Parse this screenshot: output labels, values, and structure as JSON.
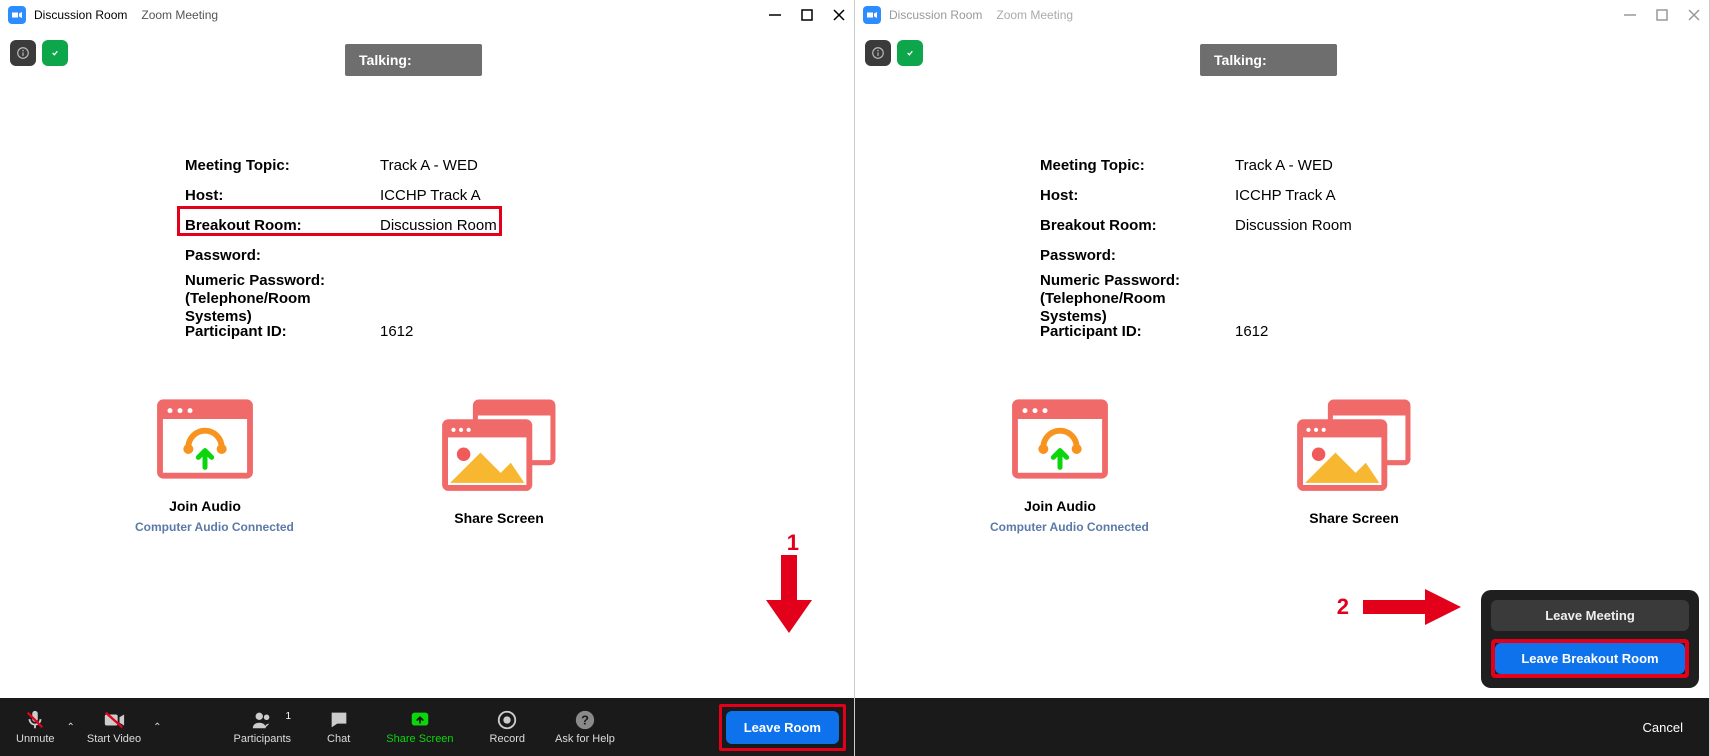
{
  "left": {
    "titlebar": {
      "room": "Discussion Room",
      "app": "Zoom Meeting"
    },
    "talking_label": "Talking:",
    "info": {
      "rows": [
        {
          "label": "Meeting Topic:",
          "value": "Track A - WED"
        },
        {
          "label": "Host:",
          "value": "ICCHP Track A"
        },
        {
          "label": "Breakout Room:",
          "value": "Discussion Room"
        },
        {
          "label": "Password:",
          "value": ""
        },
        {
          "label": "Numeric Password:\n(Telephone/Room Systems)",
          "value": ""
        },
        {
          "label": "Participant ID:",
          "value": "1612"
        }
      ]
    },
    "tiles": {
      "join_audio": "Join Audio",
      "share_screen": "Share Screen"
    },
    "audio_note": "Computer Audio Connected",
    "annotation": {
      "number": "1"
    },
    "toolbar": {
      "unmute": "Unmute",
      "start_video": "Start Video",
      "participants": "Participants",
      "participant_count": "1",
      "chat": "Chat",
      "share_screen": "Share Screen",
      "record": "Record",
      "ask_help": "Ask for Help",
      "leave_room": "Leave Room"
    }
  },
  "right": {
    "titlebar": {
      "room": "Discussion Room",
      "app": "Zoom Meeting"
    },
    "talking_label": "Talking:",
    "info": {
      "rows": [
        {
          "label": "Meeting Topic:",
          "value": "Track A - WED"
        },
        {
          "label": "Host:",
          "value": "ICCHP Track A"
        },
        {
          "label": "Breakout Room:",
          "value": "Discussion Room"
        },
        {
          "label": "Password:",
          "value": ""
        },
        {
          "label": "Numeric Password:\n(Telephone/Room Systems)",
          "value": ""
        },
        {
          "label": "Participant ID:",
          "value": "1612"
        }
      ]
    },
    "tiles": {
      "join_audio": "Join Audio",
      "share_screen": "Share Screen"
    },
    "audio_note": "Computer Audio Connected",
    "annotation": {
      "number": "2"
    },
    "popup": {
      "leave_meeting": "Leave Meeting",
      "leave_breakout": "Leave Breakout Room"
    },
    "cancel": "Cancel"
  }
}
